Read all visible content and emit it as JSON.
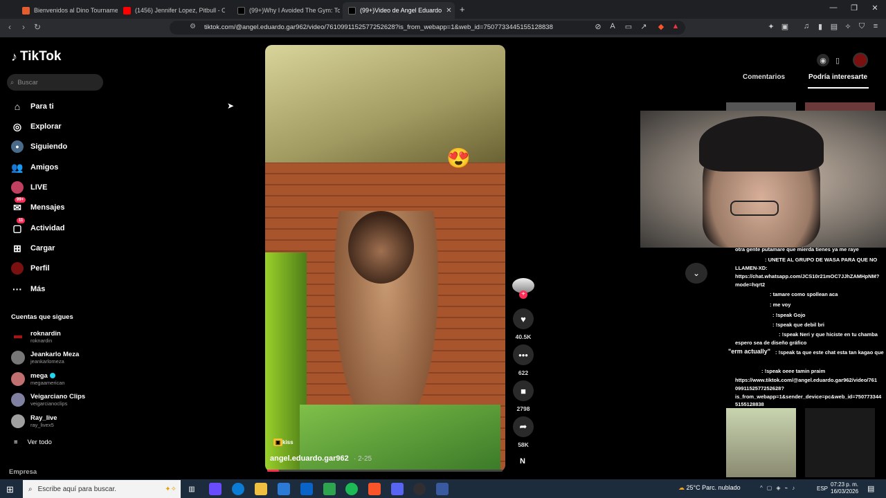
{
  "browser": {
    "tabs": [
      {
        "label": "Bienvenidos al Dino Tournament",
        "favicon_color": "#e35d2f"
      },
      {
        "label": "(1456) Jennifer Lopez, Pitbull - O",
        "favicon_color": "#ff0000"
      },
      {
        "label": "(99+)Why I Avoided The Gym: Top 5",
        "favicon_color": "#000000"
      },
      {
        "label": "(99+)Video de Angel Eduardo",
        "favicon_color": "#000000"
      }
    ],
    "url": "tiktok.com/@angel.eduardo.gar962/video/7610991152577252628?is_from_webapp=1&web_id=7507733445155128838"
  },
  "sidebar": {
    "brand": "TikTok",
    "search_placeholder": "Buscar",
    "nav": [
      {
        "label": "Para ti",
        "icon": "home-icon"
      },
      {
        "label": "Explorar",
        "icon": "compass-icon"
      },
      {
        "label": "Siguiendo",
        "icon": "following-icon"
      },
      {
        "label": "Amigos",
        "icon": "friends-icon"
      },
      {
        "label": "LIVE",
        "icon": "live-icon"
      },
      {
        "label": "Mensajes",
        "icon": "messages-icon",
        "badge": "99+"
      },
      {
        "label": "Actividad",
        "icon": "activity-icon",
        "badge": "11"
      },
      {
        "label": "Cargar",
        "icon": "upload-icon"
      },
      {
        "label": "Perfil",
        "icon": "profile-icon"
      },
      {
        "label": "Más",
        "icon": "more-icon"
      }
    ],
    "following_title": "Cuentas que sigues",
    "following": [
      {
        "name": "roknardin",
        "handle": "roknardin",
        "color": "#b01010"
      },
      {
        "name": "Jeankarlo Meza",
        "handle": "jeankarlomeza",
        "color": "#777777"
      },
      {
        "name": "mega",
        "handle": "megaamerican",
        "verified": true,
        "color": "#c07070"
      },
      {
        "name": "Veigarciano Clips",
        "handle": "veigarcianoclips",
        "color": "#8080a0"
      },
      {
        "name": "Ray_live",
        "handle": "ray_livex5",
        "color": "#a0a0a0"
      }
    ],
    "see_all": "Ver todo",
    "footer": "Empresa"
  },
  "video": {
    "emoji": "😍",
    "tag": "kiss",
    "author": "angel.eduardo.gar962",
    "date": "· 2-25",
    "progress": 0.05
  },
  "actions": {
    "likes": "40.5K",
    "comments": "622",
    "saves": "2798",
    "shares": "58K",
    "logo_letter": "N"
  },
  "right_panel": {
    "tab_comments": "Comentarios",
    "tab_suggested": "Podría interesarte"
  },
  "stream_chat": [
    "otra gente putamare que mierda tienes ya me raye",
    ": UNETE AL GRUPO DE WASA PARA QUE NO",
    "LLAMEN-XD:",
    "https://chat.whatsapp.com/JCS10r21mOC7JJhZAMHpNM?",
    "mode=hqrt2",
    ": tamare como spollean aca",
    ": me voy",
    ": !speak Gojo",
    ": !speak que debil bri",
    ": !speak Neri y que hiciste en tu chamba",
    "espero sea de diseño gráfico",
    ": !speak ta que este chat esta tan kagao que",
    "\"erm actually\"",
    ": !speak oeee tamin praim",
    "https://www.tiktok.com/@angel.eduardo.gar962/video/761",
    "0991152577252628?",
    "is_from_webapp=1&sender_device=pc&web_id=750773344",
    "5155128838"
  ],
  "taskbar": {
    "search_placeholder": "Escribe aquí para buscar.",
    "weather": "25°C  Parc. nublado",
    "lang": "ESP",
    "time": "07:23 p. m.",
    "date": "16/03/2026"
  }
}
